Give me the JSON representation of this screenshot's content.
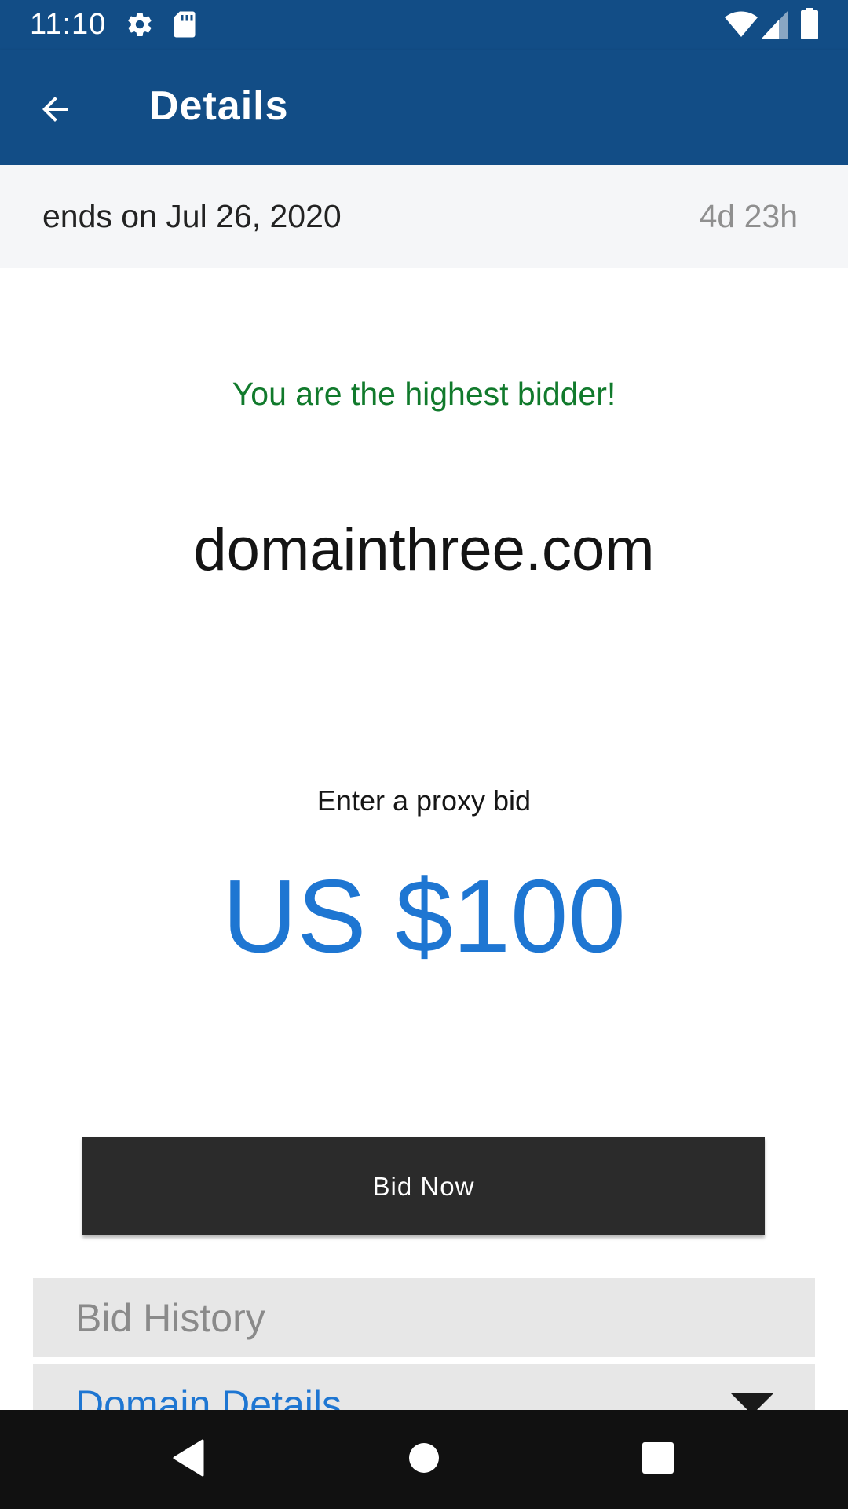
{
  "status_bar": {
    "time": "11:10",
    "icons": [
      "gear-icon",
      "sd-card-icon",
      "wifi-icon",
      "signal-icon",
      "battery-icon"
    ]
  },
  "app_bar": {
    "title": "Details",
    "back_icon": "arrow-left-icon",
    "background_color": "#124d86"
  },
  "auction": {
    "ends_text": "ends on Jul 26, 2020",
    "time_left": "4d 23h",
    "status_message": "You are the highest bidder!",
    "status_color": "#117a2c",
    "domain": "domainthree.com",
    "proxy_label": "Enter a proxy bid",
    "bid_amount": "US $100",
    "accent_color": "#1e76d2"
  },
  "actions": {
    "bid_button_label": "Bid Now"
  },
  "sections": {
    "bid_history_label": "Bid History",
    "domain_details_label": "Domain Details",
    "domain_details_icon": "caret-down-icon"
  },
  "nav_bar": {
    "icons": [
      "back-triangle-icon",
      "home-circle-icon",
      "recents-square-icon"
    ]
  }
}
